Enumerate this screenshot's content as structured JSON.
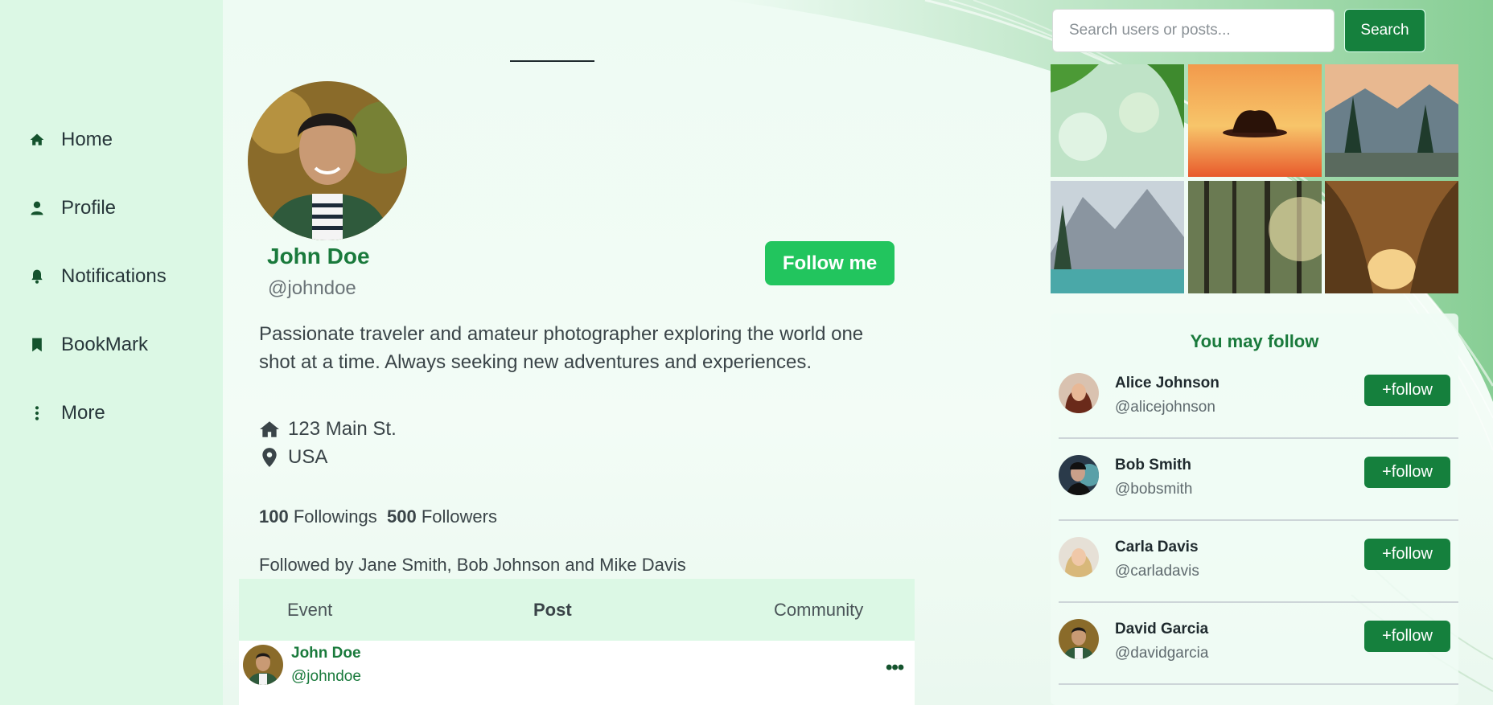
{
  "sidebar": {
    "items": [
      {
        "label": "Home",
        "icon": "home-icon"
      },
      {
        "label": "Profile",
        "icon": "user-icon"
      },
      {
        "label": "Notifications",
        "icon": "bell-icon"
      },
      {
        "label": "BookMark",
        "icon": "bookmark-icon"
      },
      {
        "label": "More",
        "icon": "more-vertical-icon"
      }
    ]
  },
  "profile": {
    "name": "John Doe",
    "handle": "@johndoe",
    "follow_label": "Follow me",
    "bio": "Passionate traveler and amateur photographer exploring the world one shot at a time. Always seeking new adventures and experiences.",
    "address": "123 Main St.",
    "country": "USA",
    "followings_count": "100",
    "followings_label": "Followings",
    "followers_count": "500",
    "followers_label": "Followers",
    "followed_by": "Followed by Jane Smith, Bob Johnson and Mike Davis"
  },
  "tabs": [
    {
      "label": "Event"
    },
    {
      "label": "Post"
    },
    {
      "label": "Community"
    }
  ],
  "active_tab": "Post",
  "post": {
    "author_name": "John Doe",
    "author_handle": "@johndoe",
    "menu_label": "•••"
  },
  "search": {
    "placeholder": "Search users or posts...",
    "button_label": "Search"
  },
  "who_to_follow": {
    "title": "You may follow",
    "button_label": "+follow",
    "users": [
      {
        "name": "Alice Johnson",
        "handle": "@alicejohnson"
      },
      {
        "name": "Bob Smith",
        "handle": "@bobsmith"
      },
      {
        "name": "Carla Davis",
        "handle": "@carladavis"
      },
      {
        "name": "David Garcia",
        "handle": "@davidgarcia"
      }
    ]
  },
  "colors": {
    "brand_green": "#1a7a3c",
    "button_green": "#15803d",
    "follow_me_green": "#22c55e",
    "sidebar_bg": "#dcf8e5"
  }
}
